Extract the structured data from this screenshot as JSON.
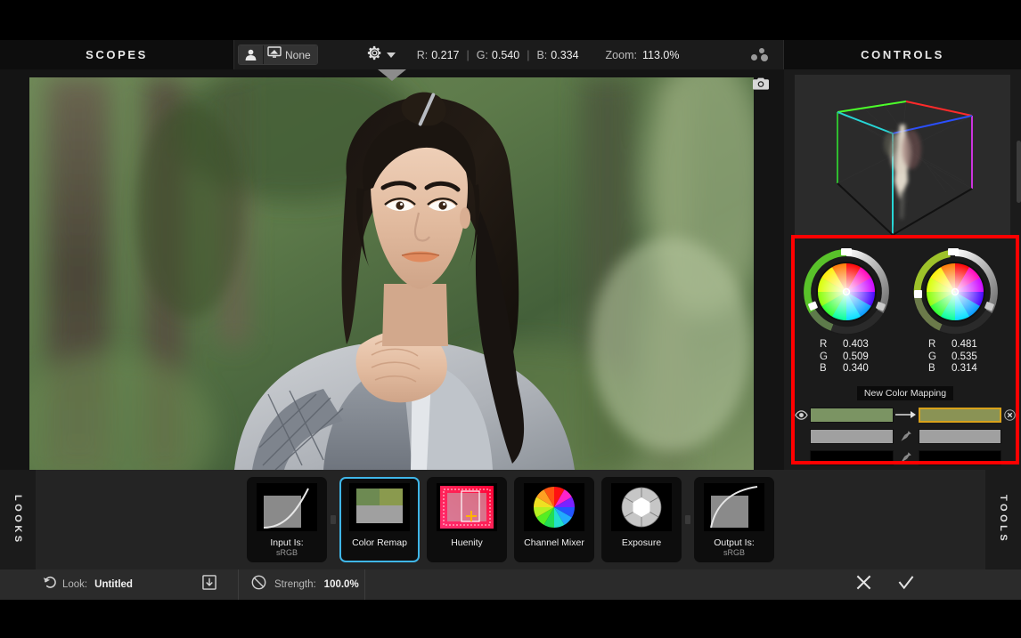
{
  "topbar": {
    "scopes_title": "SCOPES",
    "controls_title": "CONTROLS",
    "person_icon": "person-icon",
    "monitor_icon": "monitor-icon",
    "monitor_value": "None",
    "gear_icon": "gear-icon",
    "caret_icon": "chevron-down-icon",
    "readout": {
      "r_label": "R:",
      "r_value": "0.217",
      "g_label": "G:",
      "g_value": "0.540",
      "b_label": "B:",
      "b_value": "0.334",
      "sep": "|"
    },
    "zoom_label": "Zoom:",
    "zoom_value": "113.0%",
    "grid_icon": "dots-grid-icon"
  },
  "viewer": {
    "camera_icon": "camera-icon",
    "collapse_icon": "collapse-chevron-icon",
    "image_alt": "portrait of person in forest"
  },
  "controls": {
    "cube_scope": "rgb-cube-scope",
    "wheels": [
      {
        "name": "source-color-wheel",
        "r_label": "R",
        "r_value": "0.403",
        "g_label": "G",
        "g_value": "0.509",
        "b_label": "B",
        "b_value": "0.340"
      },
      {
        "name": "target-color-wheel",
        "r_label": "R",
        "r_value": "0.481",
        "g_label": "G",
        "g_value": "0.535",
        "b_label": "B",
        "b_value": "0.314"
      }
    ],
    "new_mapping_label": "New Color Mapping",
    "mapping_rows": [
      {
        "visible_icon": "eye-icon",
        "source_color": "#7b9463",
        "arrow_icon": "arrow-right-icon",
        "target_color": "#8a9355",
        "selected": true,
        "remove_icon": "close-circle-icon"
      },
      {
        "visible_icon": "",
        "source_color": "#a0a0a0",
        "arrow_icon": "pin-icon",
        "target_color": "#a0a0a0",
        "selected": false,
        "remove_icon": ""
      },
      {
        "visible_icon": "",
        "source_color": "#000000",
        "arrow_icon": "pin-icon",
        "target_color": "#000000",
        "selected": false,
        "remove_icon": ""
      }
    ],
    "highlight_color": "#ff0000",
    "selection_color": "#d9a21b"
  },
  "looks": {
    "left_rail_label": "LOOKS",
    "right_rail_label": "TOOLS",
    "accent_color": "#3fb6e8",
    "tiles": [
      {
        "name": "look-tile-input-is",
        "label": "Input Is:",
        "sublabel": "sRGB",
        "thumb": "curve-thumb",
        "selected": false
      },
      {
        "name": "look-tile-color-remap",
        "label": "Color Remap",
        "sublabel": "",
        "thumb": "swatch-thumb",
        "selected": true
      },
      {
        "name": "look-tile-huenity",
        "label": "Huenity",
        "sublabel": "",
        "thumb": "huenity-thumb",
        "selected": false
      },
      {
        "name": "look-tile-channel-mixer",
        "label": "Channel Mixer",
        "sublabel": "",
        "thumb": "colorwheel-thumb",
        "selected": false
      },
      {
        "name": "look-tile-exposure",
        "label": "Exposure",
        "sublabel": "",
        "thumb": "aperture-thumb",
        "selected": false
      },
      {
        "name": "look-tile-output-is",
        "label": "Output Is:",
        "sublabel": "sRGB",
        "thumb": "curve2-thumb",
        "selected": false
      }
    ]
  },
  "bottombar": {
    "undo_icon": "undo-icon",
    "look_label": "Look:",
    "look_value": "Untitled",
    "save_icon": "save-icon",
    "bypass_icon": "bypass-icon",
    "strength_label": "Strength:",
    "strength_value": "100.0%",
    "cancel_icon": "close-x-icon",
    "confirm_icon": "check-icon"
  }
}
